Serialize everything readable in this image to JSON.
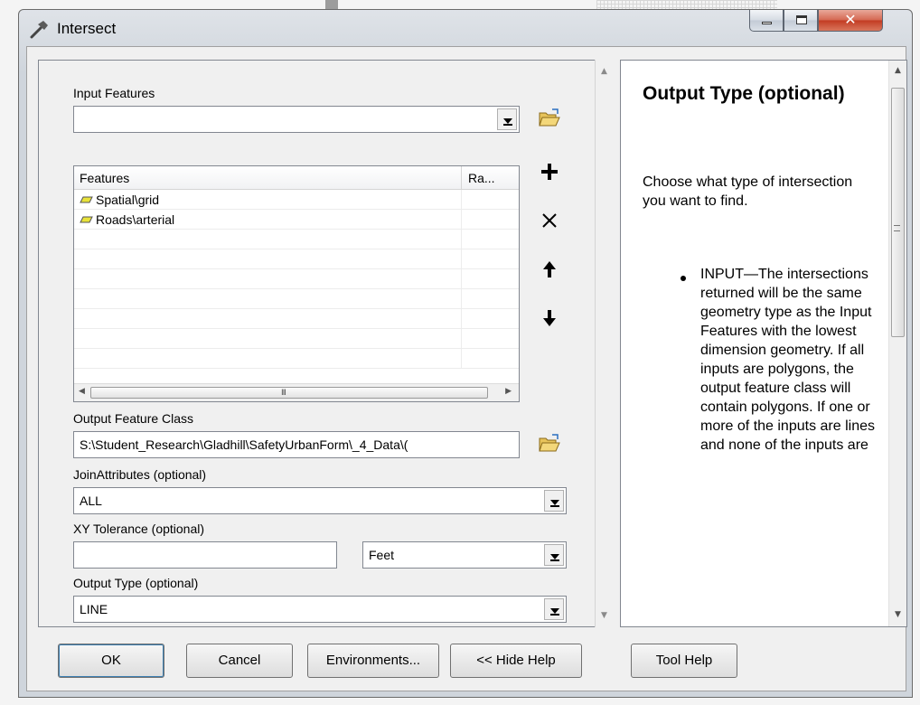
{
  "window": {
    "title": "Intersect"
  },
  "params": {
    "input_features": {
      "label": "Input Features",
      "value": ""
    },
    "features_list": {
      "columns": [
        "Features",
        "Ra..."
      ],
      "rows": [
        {
          "name": "Spatial\\grid",
          "rank": ""
        },
        {
          "name": "Roads\\arterial",
          "rank": ""
        }
      ],
      "scroll_grip": "III"
    },
    "output_feature_class": {
      "label": "Output Feature Class",
      "value": "S:\\Student_Research\\Gladhill\\SafetyUrbanForm\\_4_Data\\("
    },
    "join_attributes": {
      "label": "JoinAttributes (optional)",
      "value": "ALL"
    },
    "xy_tolerance": {
      "label": "XY Tolerance (optional)",
      "value": "",
      "unit": "Feet"
    },
    "output_type": {
      "label": "Output Type (optional)",
      "value": "LINE"
    }
  },
  "help": {
    "title": "Output Type (optional)",
    "description": "Choose what type of intersection you want to find.",
    "bullet": "INPUT—The intersections returned will be the same geometry type as the Input Features with the lowest dimension geometry. If all inputs are polygons, the output feature class will contain polygons. If one or more of the inputs are lines and none of the inputs are"
  },
  "buttons": {
    "ok": "OK",
    "cancel": "Cancel",
    "environments": "Environments...",
    "hide_help": "<< Hide Help",
    "tool_help": "Tool Help"
  },
  "icons": {
    "tool": "hammer-icon",
    "browse": "folder-open-icon",
    "add": "plus-icon",
    "remove": "x-icon",
    "up": "arrow-up-icon",
    "down": "arrow-down-icon",
    "feature": "polygon-layer-icon"
  },
  "colors": {
    "close_button": "#c23b22",
    "feature_icon": "#e8e23a"
  }
}
